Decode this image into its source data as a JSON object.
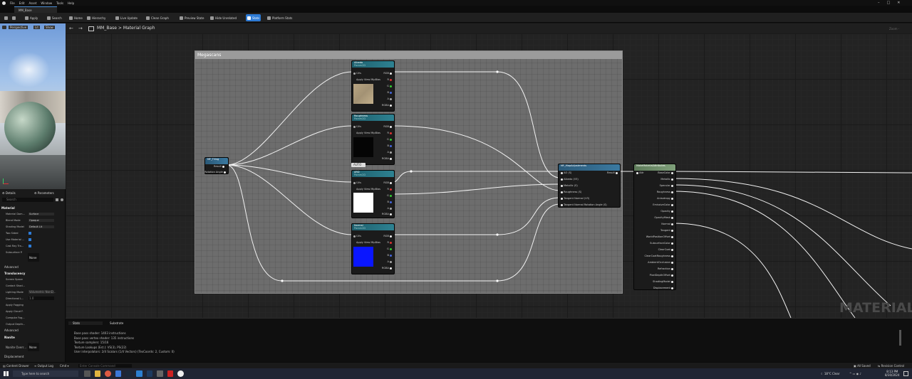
{
  "menu": [
    "File",
    "Edit",
    "Asset",
    "Window",
    "Tools",
    "Help"
  ],
  "tab_title": "MM_Base",
  "toolbar": {
    "apply": "Apply",
    "search": "Search",
    "home": "Home",
    "hierarchy": "Hierarchy",
    "live_update": "Live Update",
    "clean_graph": "Clean Graph",
    "preview_state": "Preview State",
    "hide_unrelated": "Hide Unrelated",
    "stats": "Stats",
    "platform_stats": "Platform Stats"
  },
  "viewport": {
    "perspective": "Perspective",
    "lit": "Lit",
    "show": "Show"
  },
  "graph_header": {
    "asset": "MM_Base",
    "separator": ">",
    "name": "Material Graph",
    "zoom": "Zoom -"
  },
  "comment_title": "Megascans",
  "nodes": {
    "tiling": {
      "title": "MF_Tiling",
      "pins": [
        "Result",
        "Rotation Angle"
      ]
    },
    "albedo": {
      "title": "Albedo",
      "sub": "Param2D",
      "pins": [
        "UVs",
        "Apply View MipBias",
        "RGB",
        "R",
        "G",
        "B",
        "A",
        "RGBA"
      ]
    },
    "roughness": {
      "title": "Roughness",
      "sub": "Param2D",
      "pins": [
        "UVs",
        "Apply View MipBias",
        "RGB",
        "R",
        "G",
        "B",
        "A",
        "RGBA"
      ]
    },
    "ao": {
      "title": "ARD",
      "sub": "Param2D",
      "pins": [
        "UVs",
        "Apply View MipBias",
        "RGB",
        "R",
        "G",
        "B",
        "A",
        "RGBA"
      ]
    },
    "normal": {
      "title": "Normal",
      "sub": "Param2D",
      "pins": [
        "UVs",
        "Apply View MipBias",
        "RGB",
        "R",
        "G",
        "B",
        "A",
        "RGBA"
      ]
    },
    "mapadj": {
      "title": "MF_MapAdjustments",
      "pins": [
        "AO (S)",
        "Albedo (V3)",
        "Metallic (S)",
        "Roughness (S)",
        "Tangent Normal (V3)",
        "Tangent Normal Rotation Angle (S)",
        "Result"
      ]
    },
    "output": {
      "title": "MakeMaterialAttributes",
      "pins": [
        "BaseColor",
        "Metallic",
        "Specular",
        "Roughness",
        "Anisotropy",
        "EmissiveColor",
        "Opacity",
        "OpacityMask",
        "Normal",
        "Tangent",
        "WorldPositionOffset",
        "SubsurfaceColor",
        "ClearCoat",
        "ClearCoatRoughness",
        "AmbientOcclusion",
        "Refraction",
        "PixelDepthOffset",
        "ShadingModel",
        "Displacement"
      ],
      "in": "Attr"
    }
  },
  "auto_label": "AUTO",
  "watermark": "MATERIAL",
  "details": {
    "tab1": "Details",
    "tab2": "Parameters",
    "search_placeholder": "Search",
    "section_material": "Material",
    "rows": [
      {
        "label": "Material Dom...",
        "value": "Surface"
      },
      {
        "label": "Blend Mode",
        "value": "Opaque"
      },
      {
        "label": "Shading Model",
        "value": "Default Lit"
      },
      {
        "label": "Two Sided",
        "value": ""
      },
      {
        "label": "Use Material ...",
        "value": ""
      },
      {
        "label": "Cast Ray Tra...",
        "value": ""
      },
      {
        "label": "Subsurface P.",
        "value": "None"
      }
    ],
    "section_advanced": "Advanced",
    "section_translucency": "Translucency",
    "trows": [
      "Screen Space",
      "Contact Shad...",
      "Lighting Mode",
      "Directional L...",
      "Apply Fogging",
      "Apply Cloud F.",
      "Compute Fog...",
      "Output Depth..."
    ],
    "lighting_mode_value": "Volumetric NonD...",
    "directional_value": "1.0",
    "section_advanced2": "Advanced",
    "section_nanite": "Nanite",
    "nanite_row": "Nanite Overr...",
    "nanite_value": "None",
    "displacement": "Displacement"
  },
  "stats_tab": "Stats",
  "substrate_tab": "Substrate",
  "stats": [
    "Base pass shader: 1403 instructions",
    "Base pass vertex shader: 135 instructions",
    "Texture samplers: 15/16",
    "Texture Lookups (Est.): VS(3), PS(22)",
    "User interpolators: 2/4 Scalars (1/4 Vectors) (TexCoords: 2, Custom: 0)"
  ],
  "statusbar": {
    "content_drawer": "Content Drawer",
    "output_log": "Output Log",
    "cmd": "Cmd",
    "cmd_placeholder": "Enter Console Command",
    "all_saved": "All Saved",
    "revision_control": "Revision Control"
  },
  "taskbar": {
    "search": "Type here to search",
    "weather": "18°C",
    "weather_desc": "Clear",
    "time": "8:13 PM",
    "date": "8/30/2024"
  },
  "colors": {
    "accent": "#2d7bd6",
    "comment": "#6d6d6d",
    "node_header": "#3b7aa1",
    "output_header": "#7fa07a"
  }
}
